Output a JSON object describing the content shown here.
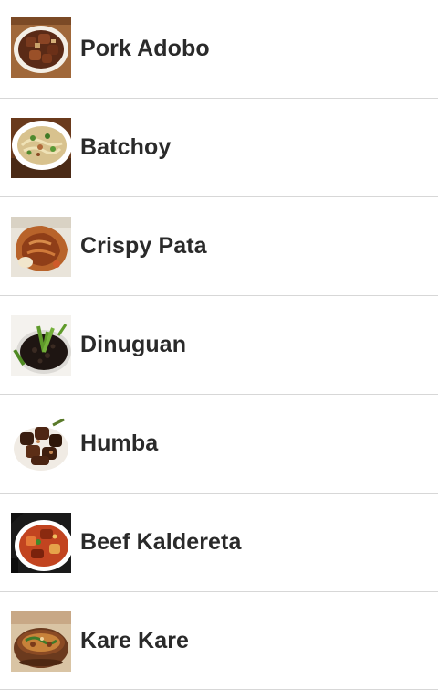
{
  "dishes": [
    {
      "name": "Pork Adobo",
      "image": "pork-adobo-image"
    },
    {
      "name": "Batchoy",
      "image": "batchoy-image"
    },
    {
      "name": "Crispy Pata",
      "image": "crispy-pata-image"
    },
    {
      "name": "Dinuguan",
      "image": "dinuguan-image"
    },
    {
      "name": "Humba",
      "image": "humba-image"
    },
    {
      "name": "Beef Kaldereta",
      "image": "beef-kaldereta-image"
    },
    {
      "name": "Kare Kare",
      "image": "kare-kare-image"
    }
  ],
  "colors": {
    "text": "#2a2a2a",
    "divider": "#d7d7d7",
    "background": "#ffffff"
  }
}
